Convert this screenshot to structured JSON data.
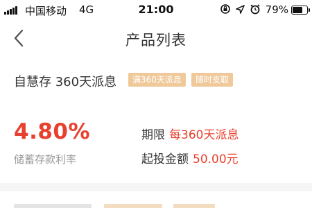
{
  "status_bar": {
    "carrier": "中国移动",
    "network": "4G",
    "time": "21:00",
    "battery_percent": "79%",
    "battery_level": 0.79,
    "icons": [
      "orientation-lock-icon",
      "location-arrow-icon",
      "alarm-clock-icon"
    ]
  },
  "nav": {
    "back_icon": "chevron-left-icon",
    "title": "产品列表"
  },
  "product": {
    "name": "自慧存 360天派息",
    "tags": [
      "满360天派息",
      "随时支取"
    ],
    "rate": "4.80%",
    "rate_label": "储蓄存款利率",
    "details": [
      {
        "label": "期限",
        "value": "每360天派息"
      },
      {
        "label": "起投金额",
        "value": "50.00元"
      }
    ]
  },
  "colors": {
    "accent_red": "#e8402e",
    "tag_background": "#f0c99b",
    "label_gray": "#999999",
    "text_dark": "#333333",
    "separator": "#f5f5f5"
  }
}
